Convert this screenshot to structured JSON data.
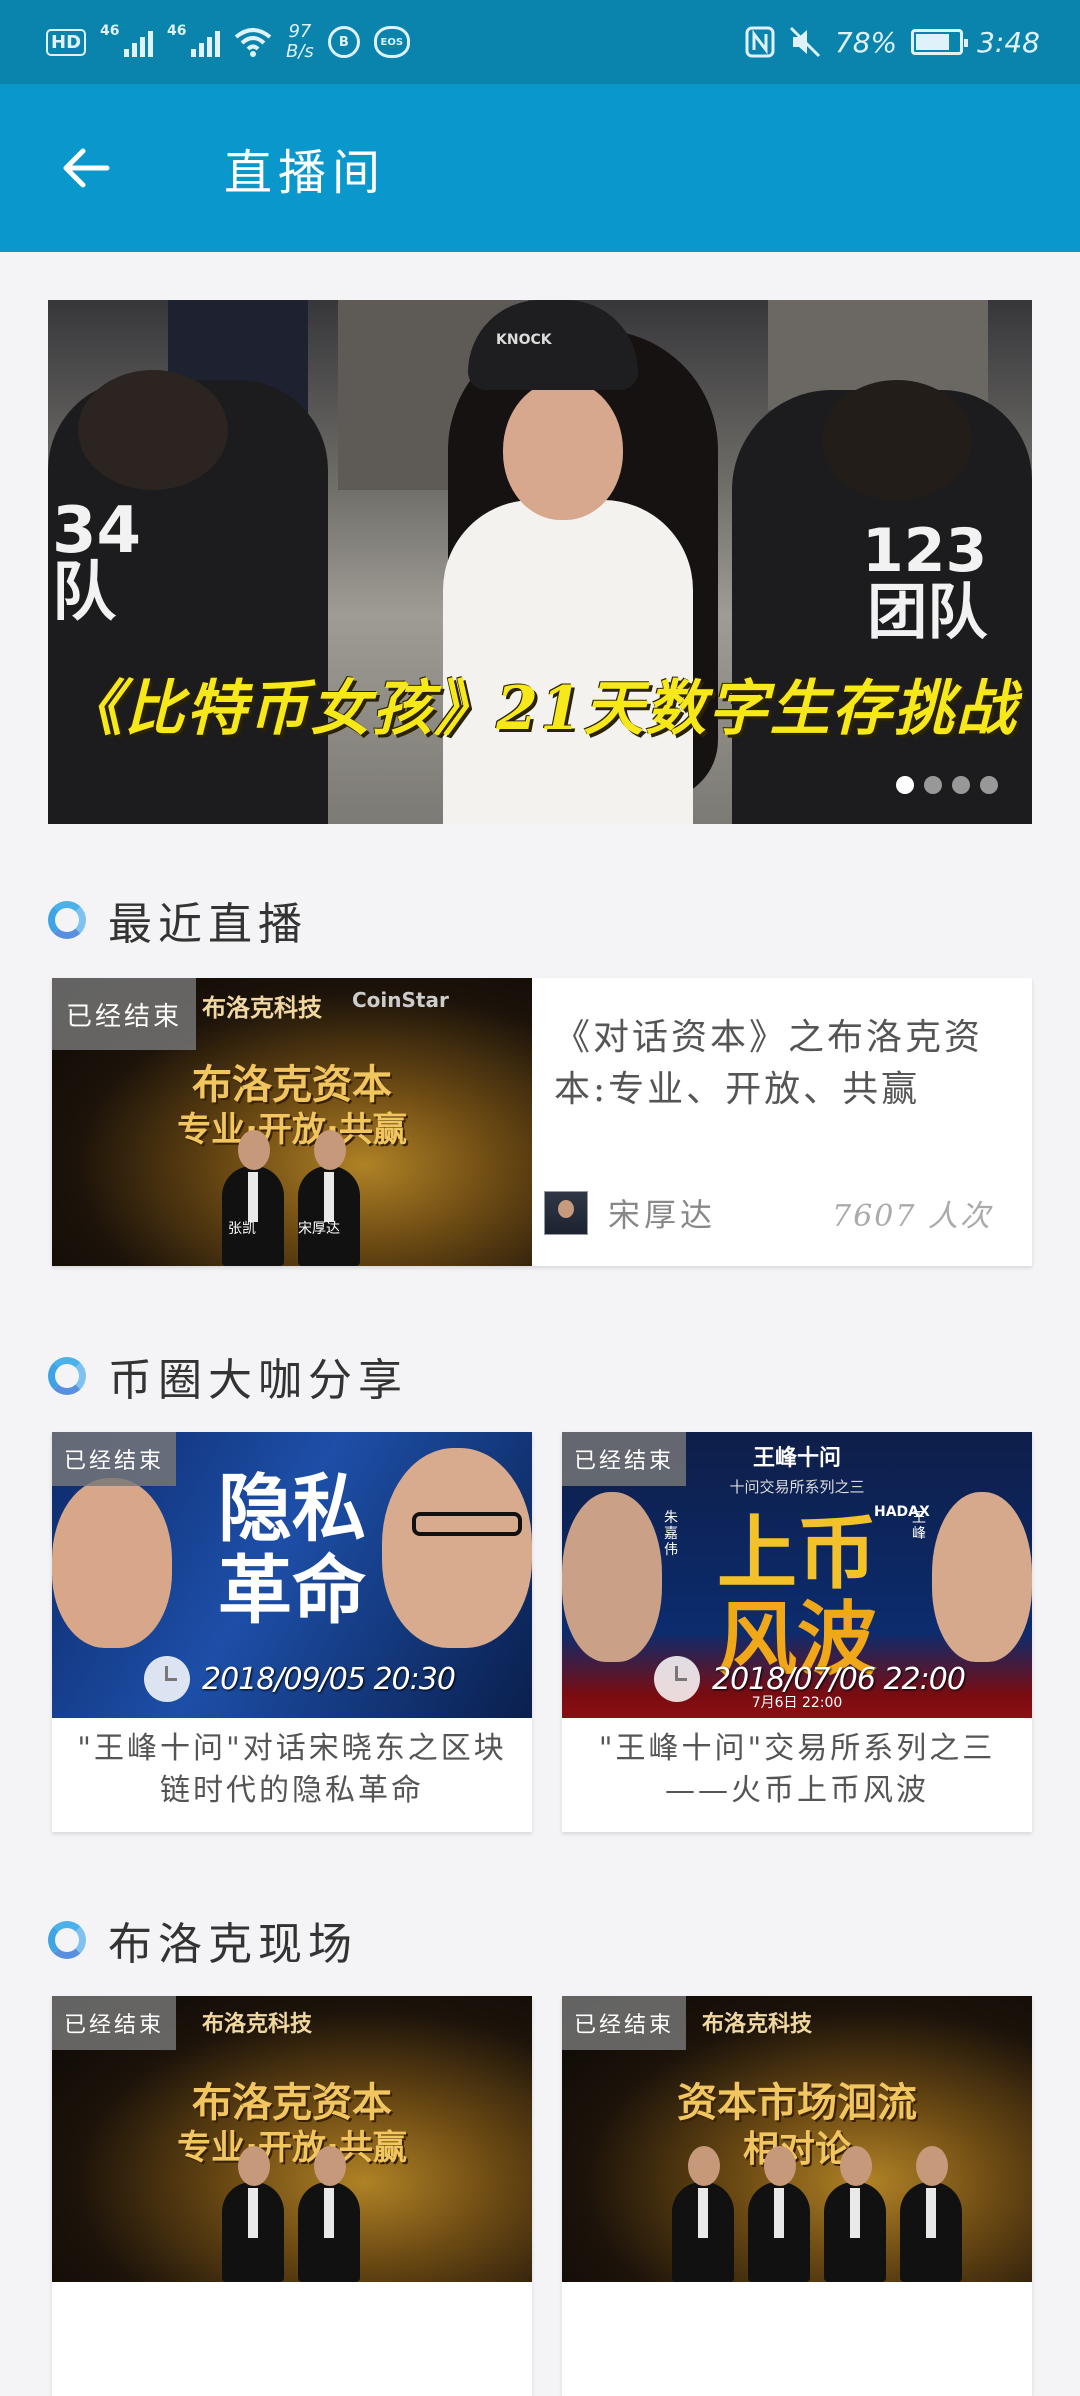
{
  "status_bar": {
    "hd": "HD",
    "sig1": "46",
    "sig2": "46",
    "speed_value": "97",
    "speed_unit": "B/s",
    "b_icon": "B",
    "eos_icon": "EOS",
    "battery_pct": "78%",
    "battery_level": 0.78,
    "time": "3:48",
    "icons": [
      "nfc-icon",
      "mute-icon",
      "wifi-icon"
    ]
  },
  "app_bar": {
    "title": "直播间",
    "back_icon": "arrow-left-icon"
  },
  "banner": {
    "caption": "《比特币女孩》21天数字生存挑战",
    "shirt_left": "34\n队",
    "shirt_right": "123\n团队",
    "cap_text": "KNOCK",
    "dots": 4,
    "active_dot": 0
  },
  "sections": {
    "recent": {
      "title": "最近直播",
      "card": {
        "badge": "已经结束",
        "logo": "布洛克科技",
        "logo2": "CoinStar",
        "headline1": "布洛克资本",
        "headline2": "专业·开放·共赢",
        "spk1": "张凯",
        "spk2": "宋厚达",
        "title": "《对话资本》之布洛克资本:专业、开放、共赢",
        "host": "宋厚达",
        "views": "7607 人次"
      }
    },
    "bigshots": {
      "title": "币圈大咖分享",
      "cards": [
        {
          "badge": "已经结束",
          "word1": "隐私",
          "word2": "革命",
          "time": "2018/09/05 20:30",
          "title": "\"王峰十问\"对话宋晓东之区块链时代的隐私革命"
        },
        {
          "badge": "已经结束",
          "header": "王峰十问",
          "sub": "十问交易所系列之三",
          "word1": "上币",
          "word2": "风波",
          "brand": "HADAX",
          "date_line": "7月6日 22:00",
          "name_left": "朱嘉伟",
          "name_right": "王峰",
          "time": "2018/07/06 22:00",
          "title": "\"王峰十问\"交易所系列之三——火币上币风波"
        }
      ]
    },
    "blockscene": {
      "title": "布洛克现场",
      "cards": [
        {
          "badge": "已经结束",
          "logo": "布洛克科技",
          "headline1": "布洛克资本",
          "headline2": "专业·开放·共赢"
        },
        {
          "badge": "已经结束",
          "logo": "布洛克科技",
          "headline1": "资本市场洄流",
          "headline2": "相对论"
        }
      ]
    }
  },
  "colors": {
    "status_bar": "#0a83ad",
    "app_bar": "#0a98cc",
    "background": "#f4f4f6",
    "banner_caption": "#f7e81a",
    "ring": "#4ab1ea"
  }
}
